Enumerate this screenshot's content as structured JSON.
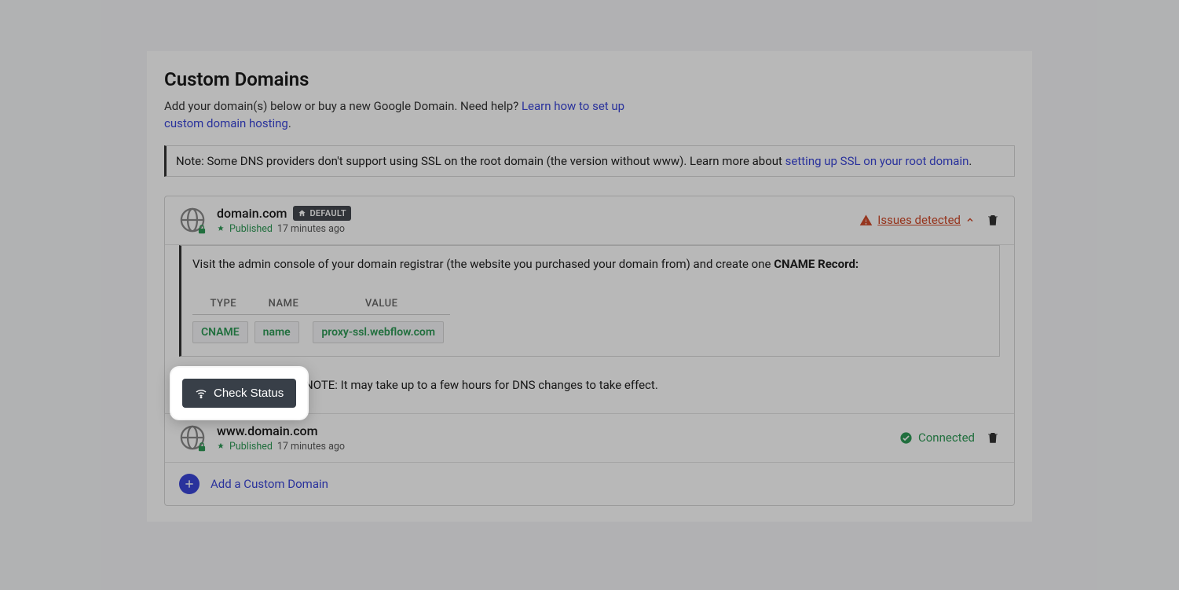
{
  "heading": "Custom Domains",
  "subtitle_prefix": "Add your domain(s) below or buy a new Google Domain. Need help? ",
  "subtitle_link": "Learn how to set up custom domain hosting",
  "subtitle_suffix": ".",
  "note_prefix": "Note: Some DNS providers don't support using SSL on the root domain (the version without www). Learn more about ",
  "note_link": "setting up SSL on your root domain",
  "note_suffix": ".",
  "domain1": {
    "name": "domain.com",
    "default_badge": "DEFAULT",
    "published": "Published",
    "time": "17 minutes ago",
    "issues": "Issues detected"
  },
  "instr_prefix": "Visit the admin console of your domain registrar (the website you purchased your domain from) and create one ",
  "instr_bold": "CNAME Record:",
  "dns": {
    "th_type": "TYPE",
    "th_name": "NAME",
    "th_value": "VALUE",
    "type": "CNAME",
    "name": "name",
    "value": "proxy-ssl.webflow.com"
  },
  "check_status": "Check Status",
  "check_note": "NOTE: It may take up to a few hours for DNS changes to take effect.",
  "domain2": {
    "name": "www.domain.com",
    "published": "Published",
    "time": "17 minutes ago",
    "connected": "Connected"
  },
  "add_domain": "Add a Custom Domain"
}
